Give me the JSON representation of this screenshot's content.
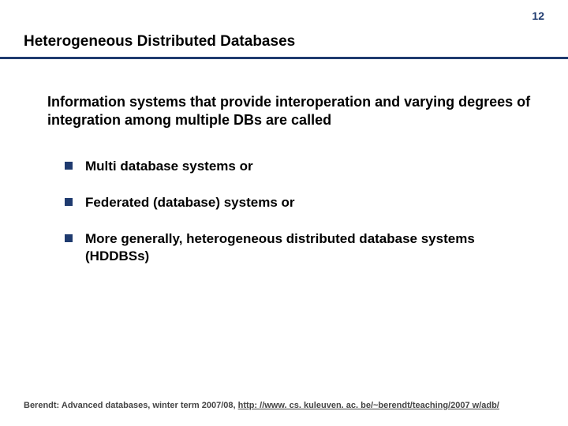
{
  "page_number": "12",
  "title": "Heterogeneous Distributed Databases",
  "intro": "Information systems that provide interoperation and varying degrees of integration among multiple DBs are called",
  "bullets": [
    "Multi database systems or",
    "Federated (database) systems or",
    "More  generally, heterogeneous distributed database systems (HDDBSs)"
  ],
  "footer": {
    "prefix": "Berendt: Advanced databases, winter term 2007/08, ",
    "link": "http: //www. cs. kuleuven. ac. be/~berendt/teaching/2007 w/adb/"
  }
}
